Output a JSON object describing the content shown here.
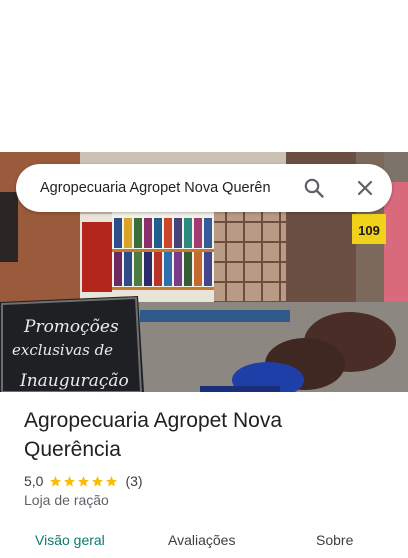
{
  "search": {
    "query": "Agropecuaria Agropet Nova Querên",
    "icons": [
      "search-icon",
      "close-icon"
    ]
  },
  "hero": {
    "sign_line1": "Promoções",
    "sign_line2": "exclusivas de",
    "sign_line3": "Inauguração",
    "price_tag": "109"
  },
  "place": {
    "name": "Agropecuaria Agropet Nova Querência",
    "rating_value": "5,0",
    "rating_stars": 5,
    "review_count": "(3)",
    "category": "Loja de ração"
  },
  "tabs": [
    {
      "label": "Visão geral",
      "active": true
    },
    {
      "label": "Avaliações",
      "active": false
    },
    {
      "label": "Sobre",
      "active": false
    }
  ],
  "colors": {
    "accent": "#0b7a70",
    "star": "#fbbc04",
    "text": "#202124",
    "secondary_text": "#5f6368"
  }
}
